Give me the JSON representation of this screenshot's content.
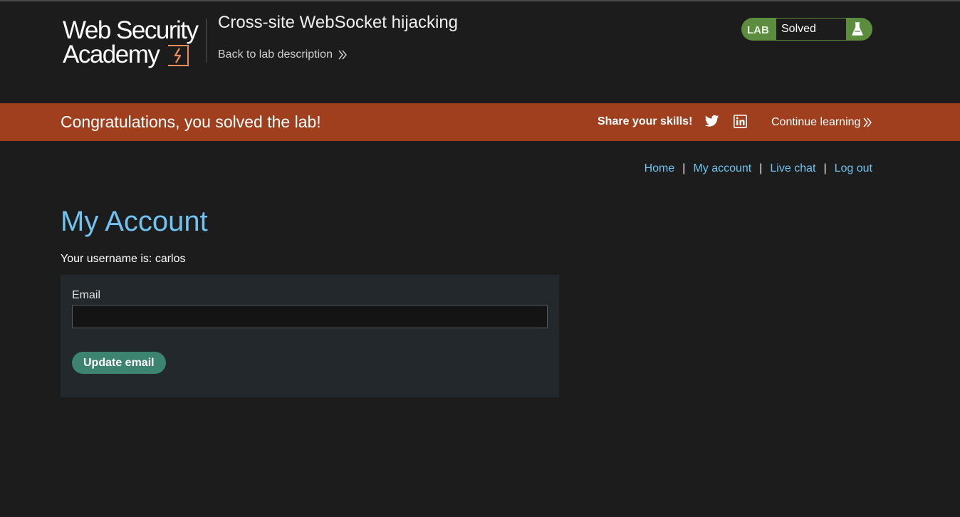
{
  "header": {
    "logo_line1": "Web Security",
    "logo_line2": "Academy",
    "lab_title": "Cross-site WebSocket hijacking",
    "back_link": "Back to lab description",
    "lab_tag": "LAB",
    "lab_state": "Solved"
  },
  "banner": {
    "message": "Congratulations, you solved the lab!",
    "share_label": "Share your skills!",
    "continue_label": "Continue learning"
  },
  "nav": {
    "items": [
      "Home",
      "My account",
      "Live chat",
      "Log out"
    ],
    "separator": "|"
  },
  "main": {
    "title": "My Account",
    "username_line": "Your username is: carlos",
    "email_label": "Email",
    "email_value": "",
    "update_button": "Update email"
  },
  "colors": {
    "background": "#1c1c1c",
    "banner": "#9f3f1e",
    "link": "#70c3f0",
    "lab_status": "#5c8c3e",
    "button": "#3c8370",
    "logo_mark": "#f08b5a"
  },
  "icons": {
    "logo_mark": "lightning-bolt-icon",
    "back_link": "double-chevron-right-icon",
    "flask": "flask-icon",
    "twitter": "twitter-icon",
    "linkedin": "linkedin-icon",
    "continue": "double-chevron-right-icon"
  }
}
